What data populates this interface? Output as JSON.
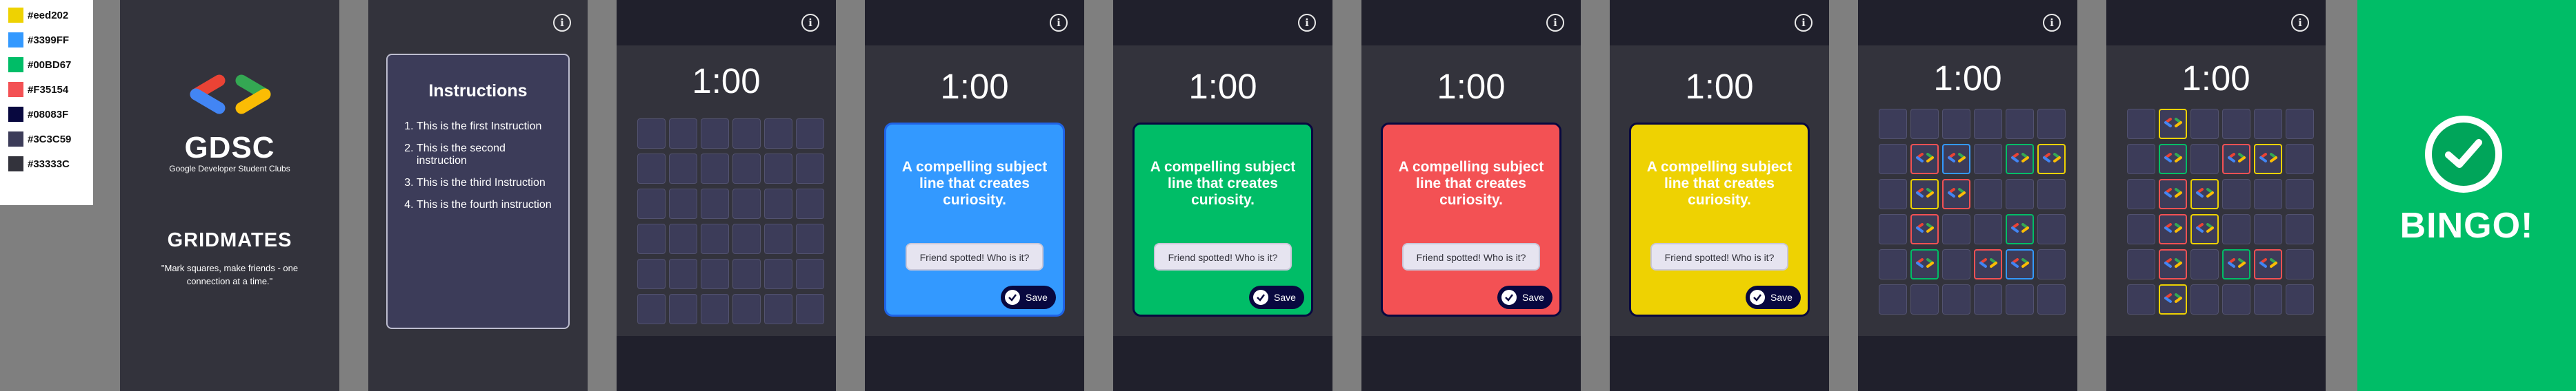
{
  "palette": [
    {
      "hex": "#eed202",
      "label": "#eed202"
    },
    {
      "hex": "#3399FF",
      "label": "#3399FF"
    },
    {
      "hex": "#00BD67",
      "label": "#00BD67"
    },
    {
      "hex": "#F35154",
      "label": "#F35154"
    },
    {
      "hex": "#08083F",
      "label": "#08083F"
    },
    {
      "hex": "#3C3C59",
      "label": "#3C3C59"
    },
    {
      "hex": "#33333C",
      "label": "#33333C"
    }
  ],
  "splash": {
    "logo_text": "GDSC",
    "logo_subtitle": "Google Developer Student Clubs",
    "app_title": "GRIDMATES",
    "tagline": "\"Mark squares, make friends - one connection at a time.\""
  },
  "instructions": {
    "title": "Instructions",
    "items": [
      "This is the first Instruction",
      "This is the second instruction",
      "This is the third Instruction",
      "This is the fourth instruction"
    ]
  },
  "timer": "1:00",
  "info_icon": "info-icon",
  "prompt": {
    "text": "A compelling subject line that creates curiosity.",
    "button": "Friend spotted! Who is it?",
    "save": "Save"
  },
  "card_colors": {
    "blue": {
      "bg": "#3399FF",
      "border": "#1f63e6"
    },
    "green": {
      "bg": "#00BD67",
      "border": "#08083F"
    },
    "red": {
      "bg": "#F35154",
      "border": "#08083F"
    },
    "yellow": {
      "bg": "#eed202",
      "border": "#08083F"
    }
  },
  "grid_partial": [
    [
      0,
      0,
      0,
      0,
      0,
      0
    ],
    [
      0,
      0,
      0,
      0,
      0,
      0
    ],
    [
      0,
      0,
      0,
      0,
      0,
      0
    ],
    [
      0,
      0,
      0,
      0,
      0,
      0
    ],
    [
      0,
      0,
      0,
      0,
      0,
      0
    ],
    [
      0,
      0,
      0,
      0,
      0,
      0
    ]
  ],
  "grid_marked_a": [
    [
      0,
      0,
      0,
      0,
      0,
      0
    ],
    [
      0,
      "r",
      "b",
      0,
      "g",
      "y"
    ],
    [
      0,
      "y",
      "r",
      0,
      0,
      0
    ],
    [
      0,
      "r",
      0,
      0,
      "g",
      0
    ],
    [
      0,
      "g",
      0,
      "r",
      "b",
      0
    ],
    [
      0,
      0,
      0,
      0,
      0,
      0
    ]
  ],
  "grid_marked_b": [
    [
      0,
      "y",
      0,
      0,
      0,
      0
    ],
    [
      0,
      "g",
      0,
      "r",
      "y",
      0
    ],
    [
      0,
      "r",
      "y",
      0,
      0,
      0
    ],
    [
      0,
      "r",
      "y",
      0,
      0,
      0
    ],
    [
      0,
      "r",
      0,
      "g",
      "r",
      0
    ],
    [
      0,
      "y",
      0,
      0,
      0,
      0
    ]
  ],
  "bingo_text": "BINGO!"
}
